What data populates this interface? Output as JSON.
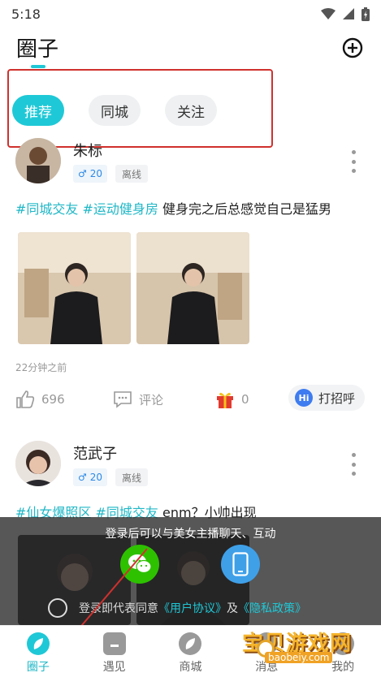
{
  "status_bar": {
    "time": "5:18"
  },
  "header": {
    "title": "圈子"
  },
  "tabs": [
    {
      "label": "推荐",
      "active": true
    },
    {
      "label": "同城",
      "active": false
    },
    {
      "label": "关注",
      "active": false
    }
  ],
  "posts": [
    {
      "username": "朱标",
      "gender_symbol": "♂",
      "age": "20",
      "status": "离线",
      "tags": [
        "#同城交友",
        "#运动健身房"
      ],
      "text": "健身完之后总感觉自己是猛男",
      "time": "22分钟之前",
      "likes": "696",
      "comment_label": "评论",
      "gifts": "0",
      "greet_icon_text": "Hi",
      "greet_label": "打招呼"
    },
    {
      "username": "范武子",
      "gender_symbol": "♂",
      "age": "20",
      "status": "离线",
      "tags": [
        "#仙女爆照区",
        "#同城交友"
      ],
      "text": "enm？小帅出现"
    }
  ],
  "login_overlay": {
    "message": "登录后可以与美女主播聊天、互动",
    "agree_prefix": "登录即代表同意",
    "user_agreement": "《用户协议》",
    "and": "及",
    "privacy_policy": "《隐私政策》"
  },
  "bottom_nav": [
    {
      "label": "圈子",
      "active": true
    },
    {
      "label": "遇见",
      "active": false
    },
    {
      "label": "商城",
      "active": false
    },
    {
      "label": "消息",
      "active": false
    },
    {
      "label": "我的",
      "active": false
    }
  ],
  "watermark": {
    "text": "宝贝游戏网",
    "url": "baobeiy.com"
  },
  "colors": {
    "accent": "#1fc8d6",
    "annotation_red": "#d0312d",
    "wechat_green": "#2dc100",
    "phone_blue": "#3fa0e8"
  }
}
